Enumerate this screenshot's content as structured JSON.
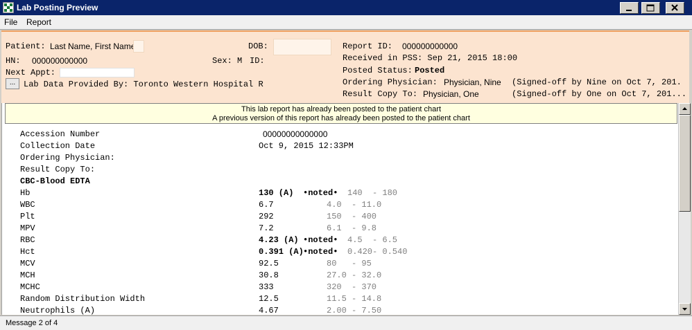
{
  "window": {
    "title": "Lab Posting Preview"
  },
  "menu": {
    "items": [
      "File",
      "Report"
    ]
  },
  "header": {
    "patient_label": "Patient:",
    "patient_name": "Last Name, First Name",
    "dob_label": "DOB:",
    "hn_label": "HN:",
    "hn_value": "000000000000",
    "sex_label": "Sex: M",
    "id_label": "ID:",
    "next_appt_label": "Next Appt:",
    "lab_provider_button": "...",
    "lab_provider": "Lab Data Provided By: Toronto Western Hospital R",
    "report_id_label": "Report ID:",
    "report_id_value": "000000000000",
    "received": "Received in PSS: Sep 21, 2015 18:00",
    "posted_status_label": "Posted Status:",
    "posted_status_value": "Posted",
    "ordering_label": "Ordering Physician:",
    "ordering_value": "Physician, Nine",
    "ordering_signoff": "(Signed-off by Nine on Oct 7, 201.",
    "copy_label": "Result Copy To:",
    "copy_value": "Physician, One",
    "copy_signoff": "(Signed-off by One on Oct 7, 201..."
  },
  "notice": {
    "line1": "This lab report has already been posted to the patient chart",
    "line2": "A previous version of this report has already been posted to the patient chart"
  },
  "report": {
    "accession_label": "Accession Number",
    "accession_value": "00000000000000",
    "collection_label": "Collection Date",
    "collection_value": "Oct 9, 2015 12:33PM",
    "ordering_label": "Ordering Physician:",
    "copy_label": "Result Copy To:",
    "section": "CBC-Blood EDTA",
    "results": [
      {
        "name": "Hb",
        "value": "130 (A)",
        "flag": "•noted•",
        "ref": "140  - 180",
        "abnormal": true
      },
      {
        "name": "WBC",
        "value": "6.7",
        "flag": "",
        "ref": "4.0  - 11.0",
        "abnormal": false
      },
      {
        "name": "Plt",
        "value": "292",
        "flag": "",
        "ref": "150  - 400",
        "abnormal": false
      },
      {
        "name": "MPV",
        "value": "7.2",
        "flag": "",
        "ref": "6.1  - 9.8",
        "abnormal": false
      },
      {
        "name": "RBC",
        "value": "4.23 (A)",
        "flag": "•noted•",
        "ref": "4.5  - 6.5",
        "abnormal": true
      },
      {
        "name": "Hct",
        "value": "0.391 (A)",
        "flag": "•noted•",
        "ref": "0.420- 0.540",
        "abnormal": true
      },
      {
        "name": "MCV",
        "value": "92.5",
        "flag": "",
        "ref": "80   - 95",
        "abnormal": false
      },
      {
        "name": "MCH",
        "value": "30.8",
        "flag": "",
        "ref": "27.0 - 32.0",
        "abnormal": false
      },
      {
        "name": "MCHC",
        "value": "333",
        "flag": "",
        "ref": "320  - 370",
        "abnormal": false
      },
      {
        "name": "Random Distribution Width",
        "value": "12.5",
        "flag": "",
        "ref": "11.5 - 14.8",
        "abnormal": false
      },
      {
        "name": "Neutrophils (A)",
        "value": "4.67",
        "flag": "",
        "ref": "2.00 - 7.50",
        "abnormal": false
      }
    ]
  },
  "status": {
    "text": "Message 2 of 4"
  }
}
